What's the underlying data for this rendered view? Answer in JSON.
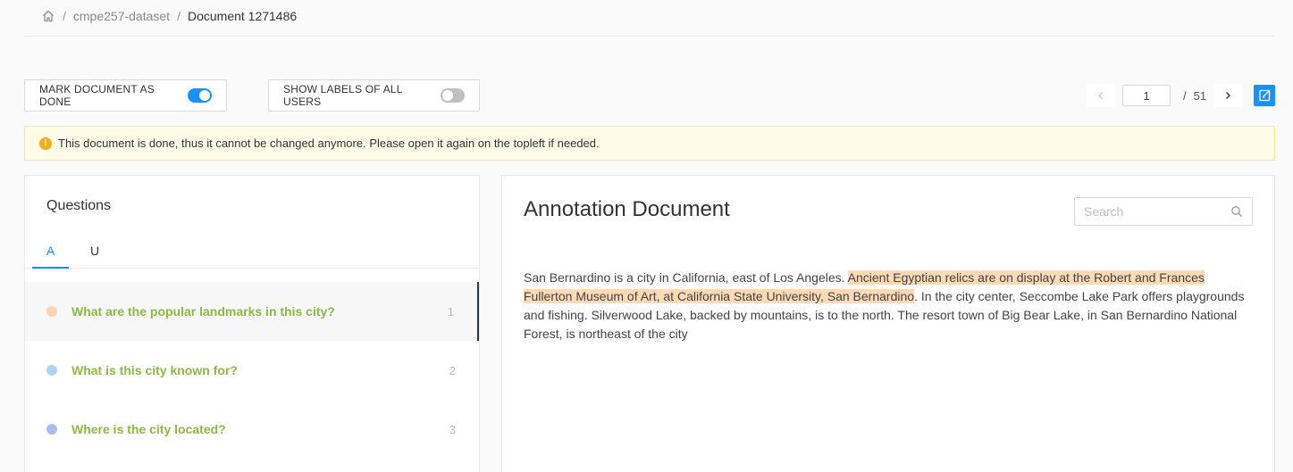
{
  "breadcrumb": {
    "home_icon": "home-icon",
    "dataset": "cmpe257-dataset",
    "document": "Document 1271486",
    "separator": "/"
  },
  "toolbar": {
    "mark_done_label": "MARK DOCUMENT AS DONE",
    "mark_done_on": true,
    "show_labels_label": "SHOW LABELS OF ALL USERS",
    "show_labels_on": false
  },
  "pager": {
    "current_page": "1",
    "separator": "/",
    "total_pages": "51",
    "prev_icon": "chevron-left-icon",
    "next_icon": "chevron-right-icon",
    "fullscreen_icon": "expand-icon"
  },
  "alert": {
    "icon": "exclamation-circle-icon",
    "message": "This document is done, thus it cannot be changed anymore. Please open it again on the topleft if needed."
  },
  "questions": {
    "title": "Questions",
    "tabs": [
      {
        "label": "A",
        "active": true
      },
      {
        "label": "U",
        "active": false
      }
    ],
    "items": [
      {
        "text": "What are the popular landmarks in this city?",
        "number": "1",
        "dot_color": "#fbd3ae",
        "selected": true
      },
      {
        "text": "What is this city known for?",
        "number": "2",
        "dot_color": "#aed3fb",
        "selected": false
      },
      {
        "text": "Where is the city located?",
        "number": "3",
        "dot_color": "#aebcf6",
        "selected": false
      }
    ]
  },
  "document": {
    "title": "Annotation Document",
    "search_placeholder": "Search",
    "search_value": "",
    "text_before": "San Bernardino is a city in California, east of Los Angeles. ",
    "text_highlight": "Ancient Egyptian relics are on display at the Robert and Frances Fullerton Museum of Art, at California State University, San Bernardino",
    "text_after": ". In the city center, Seccombe Lake Park offers playgrounds and fishing. Silverwood Lake, backed by mountains, is to the north. The resort town of Big Bear Lake, in San Bernardino National Forest, is northeast of the city",
    "highlight_color": "#fcdab6"
  },
  "colors": {
    "accent": "#1890ff",
    "question_text": "#8bbb3d",
    "alert_bg": "#fffbe6",
    "alert_border": "#ffe58f",
    "warning": "#faad14"
  }
}
